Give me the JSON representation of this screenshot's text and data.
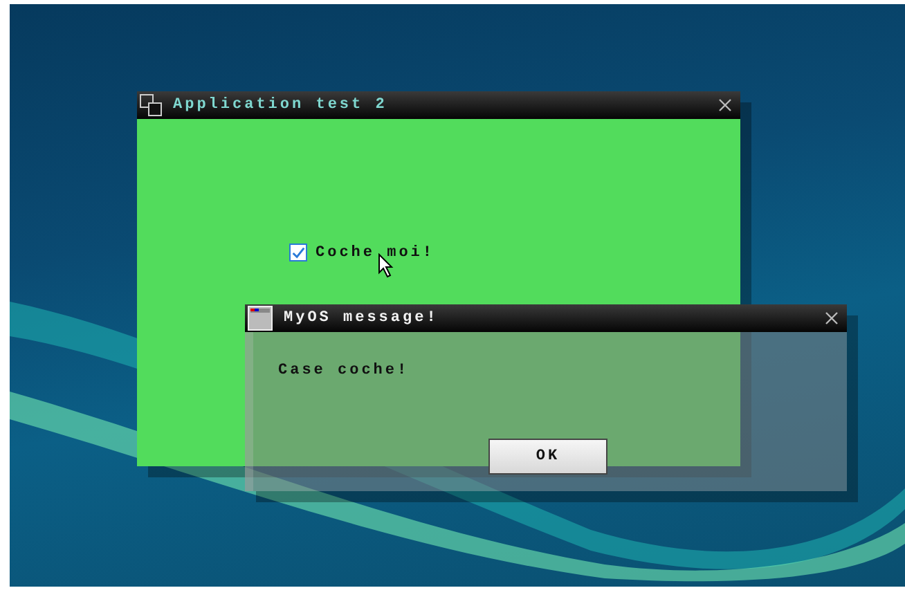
{
  "app_window": {
    "title": "Application test 2",
    "checkbox": {
      "label": "Coche moi!",
      "checked": true
    }
  },
  "message_dialog": {
    "title": "MyOS message!",
    "message": "Case coche!",
    "buttons": [
      "OK"
    ]
  }
}
